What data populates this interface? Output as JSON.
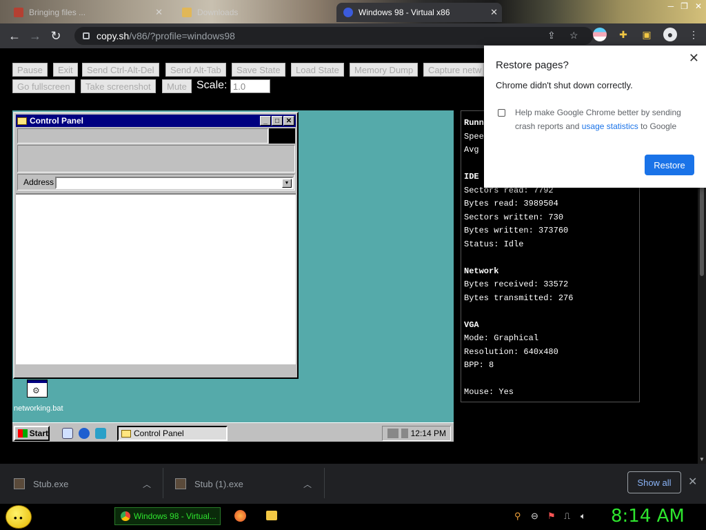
{
  "browser": {
    "tabs": [
      {
        "label": "Bringing files ...",
        "active": false
      },
      {
        "label": "Downloads",
        "active": false
      },
      {
        "label": "Windows 98 - Virtual x86",
        "active": true
      }
    ],
    "url_domain": "copy.sh",
    "url_path": "/v86/?profile=windows98"
  },
  "v86": {
    "buttons_row1": [
      "Pause",
      "Exit",
      "Send Ctrl-Alt-Del",
      "Send Alt-Tab",
      "Save State",
      "Load State",
      "Memory Dump",
      "Capture netw"
    ],
    "buttons_row2": [
      "Go fullscreen",
      "Take screenshot",
      "Mute"
    ],
    "scale_label": "Scale:",
    "scale_value": "1.0"
  },
  "win98": {
    "window_title": "Control Panel",
    "address_label": "Address",
    "desktop_icon_label": "networking.bat",
    "start_label": "Start",
    "task_label": "Control Panel",
    "clock": "12:14 PM"
  },
  "stats": {
    "lines": [
      {
        "t": "Runn",
        "h": true
      },
      {
        "t": "Spee",
        "h": false
      },
      {
        "t": "Avg",
        "h": false
      },
      {
        "t": "",
        "h": false
      },
      {
        "t": "IDE",
        "h": true
      },
      {
        "t": "Sectors read: 7792",
        "h": false
      },
      {
        "t": "Bytes read: 3989504",
        "h": false
      },
      {
        "t": "Sectors written: 730",
        "h": false
      },
      {
        "t": "Bytes written: 373760",
        "h": false
      },
      {
        "t": "Status: Idle",
        "h": false
      },
      {
        "t": "",
        "h": false
      },
      {
        "t": "Network",
        "h": true
      },
      {
        "t": "Bytes received: 33572",
        "h": false
      },
      {
        "t": "Bytes transmitted: 276",
        "h": false
      },
      {
        "t": "",
        "h": false
      },
      {
        "t": "VGA",
        "h": true
      },
      {
        "t": "Mode: Graphical",
        "h": false
      },
      {
        "t": "Resolution: 640x480",
        "h": false
      },
      {
        "t": "BPP: 8",
        "h": false
      },
      {
        "t": "",
        "h": false
      },
      {
        "t": "Mouse: Yes",
        "h": false
      }
    ]
  },
  "dialog": {
    "title": "Restore pages?",
    "message": "Chrome didn't shut down correctly.",
    "checkbox_pre": "Help make Google Chrome better by sending crash reports and ",
    "checkbox_link": "usage statistics",
    "checkbox_post": " to Google",
    "restore_label": "Restore"
  },
  "downloads": {
    "items": [
      "Stub.exe",
      "Stub (1).exe"
    ],
    "show_all": "Show all"
  },
  "os": {
    "task_label": "Windows 98 - Virtual...",
    "clock": "8:14 AM"
  },
  "colors": {
    "accent": "#1a73e8",
    "win98_desktop": "#55aaaa",
    "win98_title": "#000080",
    "os_clock": "#2ee52e"
  }
}
